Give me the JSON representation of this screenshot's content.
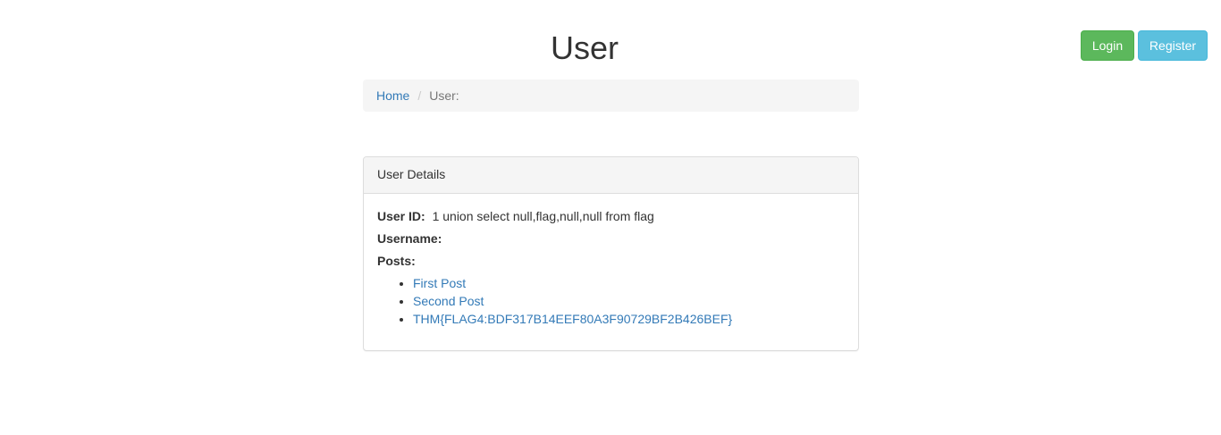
{
  "header": {
    "title": "User"
  },
  "auth": {
    "login_label": "Login",
    "register_label": "Register"
  },
  "breadcrumb": {
    "home": "Home",
    "separator": "/",
    "current": "User:"
  },
  "panel": {
    "heading": "User Details",
    "user_id_label": "User ID:",
    "user_id_value": "1 union select null,flag,null,null from flag",
    "username_label": "Username:",
    "username_value": "",
    "posts_label": "Posts:",
    "posts": [
      "First Post",
      "Second Post",
      "THM{FLAG4:BDF317B14EEF80A3F90729BF2B426BEF}"
    ]
  },
  "colors": {
    "login_button": "#5cb85c",
    "register_button": "#5bc0de",
    "link": "#337ab7"
  }
}
